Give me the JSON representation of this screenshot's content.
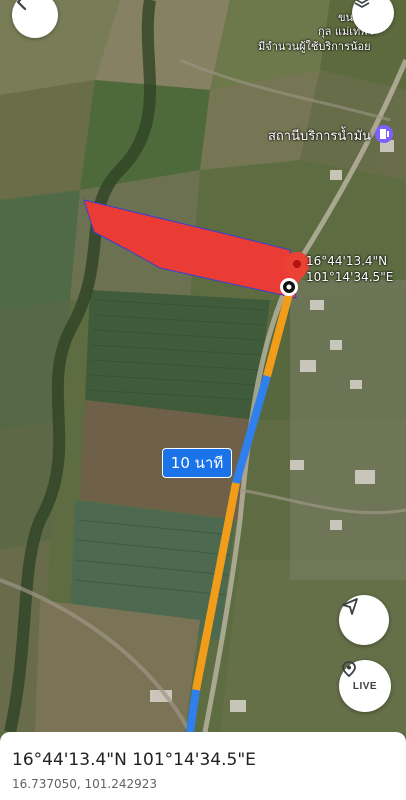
{
  "map": {
    "place_label_top_line": "ขน",
    "place_label_line1": "กุล แม่เทพวั",
    "place_label_line2": "มีจำนวนผู้ใช้บริการน้อย",
    "gas_station_label": "สถานีบริการน้ำมัน",
    "pin_coord_lat": "16°44'13.4\"N",
    "pin_coord_lng": "101°14'34.5\"E",
    "route_duration_label": "10 นาที",
    "live_label": "LIVE",
    "colors": {
      "route_blue": "#2f80ed",
      "route_orange": "#f29d1a",
      "parcel_red": "#ea3c35",
      "accent": "#1a73e8"
    }
  },
  "icons": [
    "back-arrow-icon",
    "layers-icon",
    "gas-station-icon",
    "location-pin-icon",
    "navigate-arrow-icon",
    "live-view-icon"
  ],
  "sheet": {
    "coord_dms": "16°44'13.4\"N 101°14'34.5\"E",
    "coord_decimal": "16.737050, 101.242923"
  }
}
